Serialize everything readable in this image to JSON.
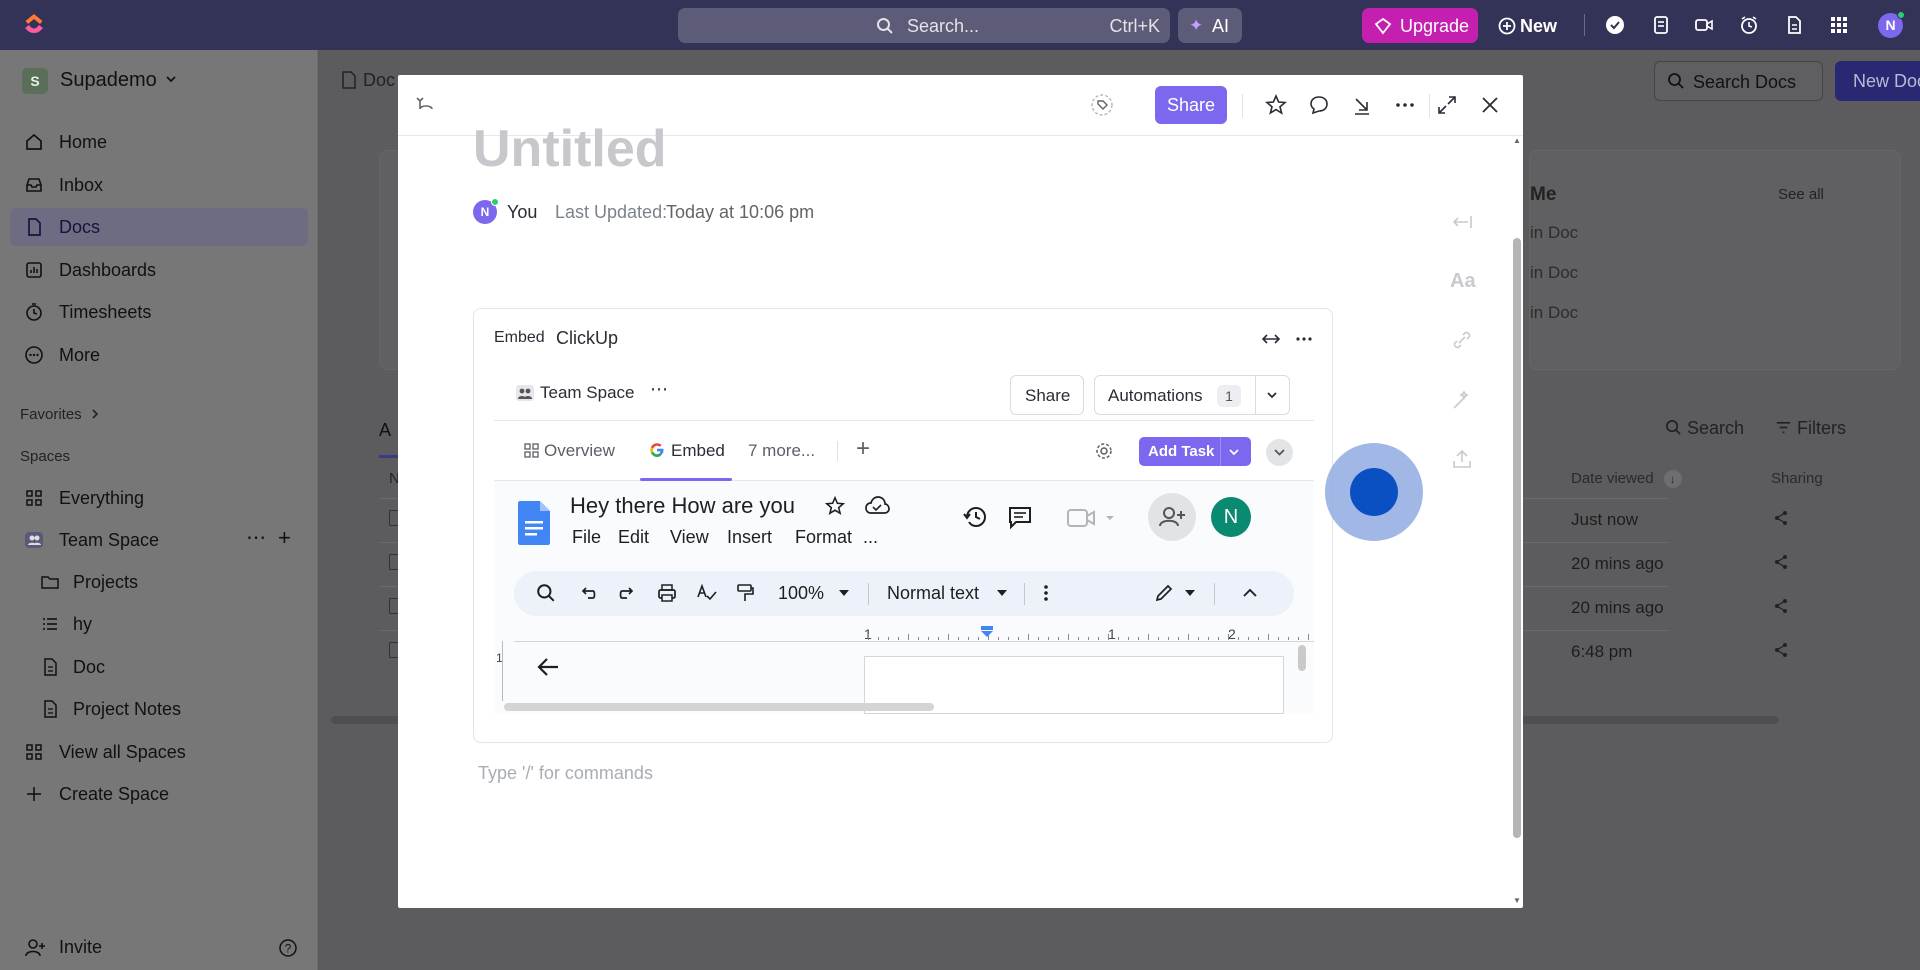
{
  "topbar": {
    "search_placeholder": "Search...",
    "search_shortcut": "Ctrl+K",
    "ai_label": "AI",
    "upgrade_label": "Upgrade",
    "new_label": "New",
    "avatar_initial": "N"
  },
  "sidebar": {
    "workspace_initial": "S",
    "workspace_name": "Supademo",
    "nav": [
      {
        "label": "Home",
        "icon": "home-icon"
      },
      {
        "label": "Inbox",
        "icon": "inbox-icon"
      },
      {
        "label": "Docs",
        "icon": "docs-icon",
        "active": true
      },
      {
        "label": "Dashboards",
        "icon": "dashboard-icon"
      },
      {
        "label": "Timesheets",
        "icon": "timer-icon"
      },
      {
        "label": "More",
        "icon": "more-icon"
      }
    ],
    "favorites_label": "Favorites",
    "spaces_label": "Spaces",
    "spaces": [
      {
        "label": "Everything"
      },
      {
        "label": "Team Space"
      },
      {
        "label": "Projects"
      },
      {
        "label": "hy"
      },
      {
        "label": "Doc"
      },
      {
        "label": "Project Notes"
      },
      {
        "label": "View all Spaces"
      },
      {
        "label": "Create Space"
      }
    ],
    "invite_label": "Invite"
  },
  "main": {
    "breadcrumb": "Doc",
    "search_docs_label": "Search Docs",
    "new_doc_label": "New Doc",
    "card_title": "Me",
    "see_all": "See all",
    "card_rows": [
      "in Doc",
      "in Doc",
      "in Doc"
    ],
    "tab_initial": "A",
    "col_initial": "N",
    "search_label": "Search",
    "filters_label": "Filters",
    "col_date_viewed": "Date viewed",
    "col_sharing": "Sharing",
    "rows": [
      "Just now",
      "20 mins ago",
      "20 mins ago",
      "6:48 pm"
    ]
  },
  "modal": {
    "share_label": "Share",
    "doc_title": "Untitled",
    "author_initial": "N",
    "author_name": "You",
    "last_updated_label": "Last Updated:",
    "last_updated_value": "Today at 10:06 pm",
    "command_placeholder": "Type '/' for commands",
    "embed": {
      "type_label": "Embed",
      "source_label": "ClickUp",
      "space_name": "Team Space",
      "share_label": "Share",
      "automations_label": "Automations",
      "automations_count": "1",
      "tabs": [
        "Overview",
        "Embed",
        "7 more..."
      ],
      "add_task_label": "Add Task",
      "gdoc": {
        "title": "Hey there How are you",
        "menu": [
          "File",
          "Edit",
          "View",
          "Insert",
          "Format",
          "..."
        ],
        "avatar_initial": "N",
        "zoom": "100%",
        "style": "Normal text",
        "ruler_numbers": [
          "1",
          "1",
          "2"
        ],
        "side_ruler": "1"
      }
    }
  }
}
